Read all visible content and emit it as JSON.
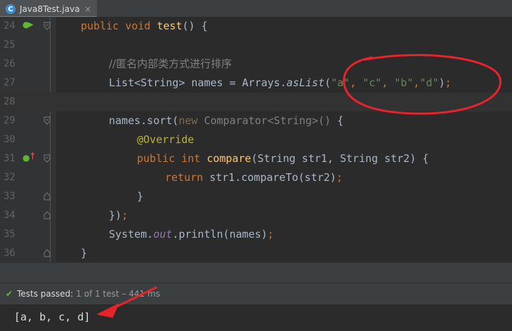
{
  "tab": {
    "icon_letter": "C",
    "label": "Java8Test.java",
    "close": "×"
  },
  "lines": {
    "l24": {
      "num": "24",
      "p1": "public void ",
      "p2": "test",
      "p3": "() {"
    },
    "l25": {
      "num": "25"
    },
    "l26": {
      "num": "26",
      "comment": "//匿名内部类方式进行排序"
    },
    "l27": {
      "num": "27",
      "p1": "List<String> names = Arrays.",
      "p2": "asList",
      "p3": "(",
      "s1": "\"a\"",
      "c1": ", ",
      "s2": "\"c\"",
      "c2": ", ",
      "s3": "\"b\"",
      "c3": ",",
      "s4": "\"d\"",
      "p4": ")",
      "p5": ";"
    },
    "l28": {
      "num": "28"
    },
    "l29": {
      "num": "29",
      "p1": "names.sort(",
      "p2": "new ",
      "p3": "Comparator<String>() ",
      "p4": "{"
    },
    "l30": {
      "num": "30",
      "ann": "@Override"
    },
    "l31": {
      "num": "31",
      "p1": "public int ",
      "p2": "compare",
      "p3": "(String str1, String str2) {"
    },
    "l32": {
      "num": "32",
      "p1": "return ",
      "p2": "str1.compareTo(str2)",
      "p3": ";"
    },
    "l33": {
      "num": "33",
      "p1": "}"
    },
    "l34": {
      "num": "34",
      "p1": "})",
      "p2": ";"
    },
    "l35": {
      "num": "35",
      "p1": "System.",
      "p2": "out",
      "p3": ".println(names)",
      "p4": ";"
    },
    "l36": {
      "num": "36",
      "p1": "}"
    }
  },
  "status": {
    "passed": "Tests passed:",
    "detail": "1 of 1 test – 441 ms"
  },
  "console": {
    "output": "[a, b, c, d]"
  },
  "colors": {
    "annotation_red": "#e8232b",
    "passed_green": "#5fb832"
  }
}
